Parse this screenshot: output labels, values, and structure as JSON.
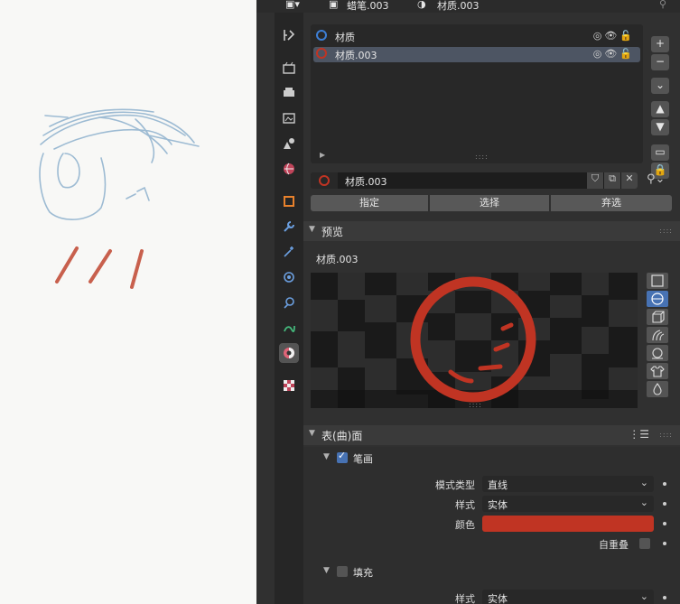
{
  "header": {
    "object_name": "蜡笔.003",
    "material_name": "材质.003"
  },
  "slots": [
    {
      "name": "材质",
      "color": "#3d7fd6",
      "selected": false
    },
    {
      "name": "材质.003",
      "color": "#c03423",
      "selected": true
    }
  ],
  "material_field": {
    "value": "材质.003"
  },
  "actions": {
    "assign": "指定",
    "select": "选择",
    "deselect": "弃选"
  },
  "preview": {
    "title": "预览",
    "material_label": "材质.003"
  },
  "surface": {
    "title": "表(曲)面",
    "stroke": {
      "title": "笔画",
      "line_type_label": "模式类型",
      "line_type_value": "直线",
      "style_label": "样式",
      "style_value": "实体",
      "color_label": "颜色",
      "color_hex": "#c03423",
      "self_overlap_label": "自重叠"
    },
    "fill": {
      "title": "填充",
      "style_label": "样式",
      "style_value": "实体"
    }
  },
  "side_buttons": {
    "add": "+",
    "remove": "−"
  }
}
